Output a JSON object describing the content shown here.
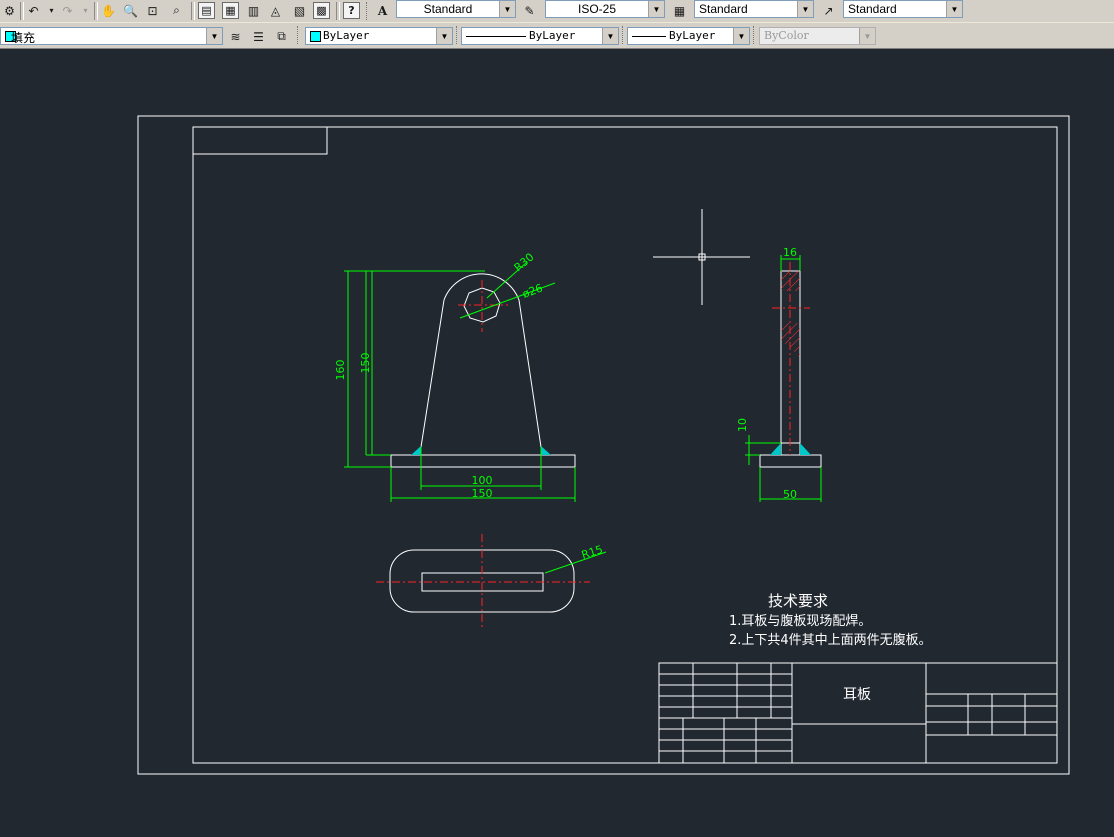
{
  "toolbar": {
    "text_style": "Standard",
    "dim_style": "ISO-25",
    "table_style": "Standard",
    "multileader_style": "Standard"
  },
  "properties": {
    "layer": "填充",
    "color": "ByLayer",
    "linetype": "ByLayer",
    "lineweight": "ByLayer",
    "plot_style": "ByColor"
  },
  "drawing": {
    "dimensions": {
      "height_overall": "160",
      "height_inner": "150",
      "radius_top": "R30",
      "hole_diameter": "ø26",
      "base_inner": "100",
      "base_width": "150",
      "side_thickness": "16",
      "side_base_height": "10",
      "side_base_width": "50",
      "slot_radius": "R15"
    },
    "notes": {
      "title": "技术要求",
      "line1": "1.耳板与腹板现场配焊。",
      "line2": "2.上下共4件其中上面两件无腹板。"
    },
    "title_block": {
      "part_name": "耳板"
    }
  },
  "colors": {
    "background": "#212830",
    "geometry": "#ffffff",
    "dimension": "#00ff00",
    "centerline": "#ff0000",
    "hatch": "#00c8c8"
  }
}
